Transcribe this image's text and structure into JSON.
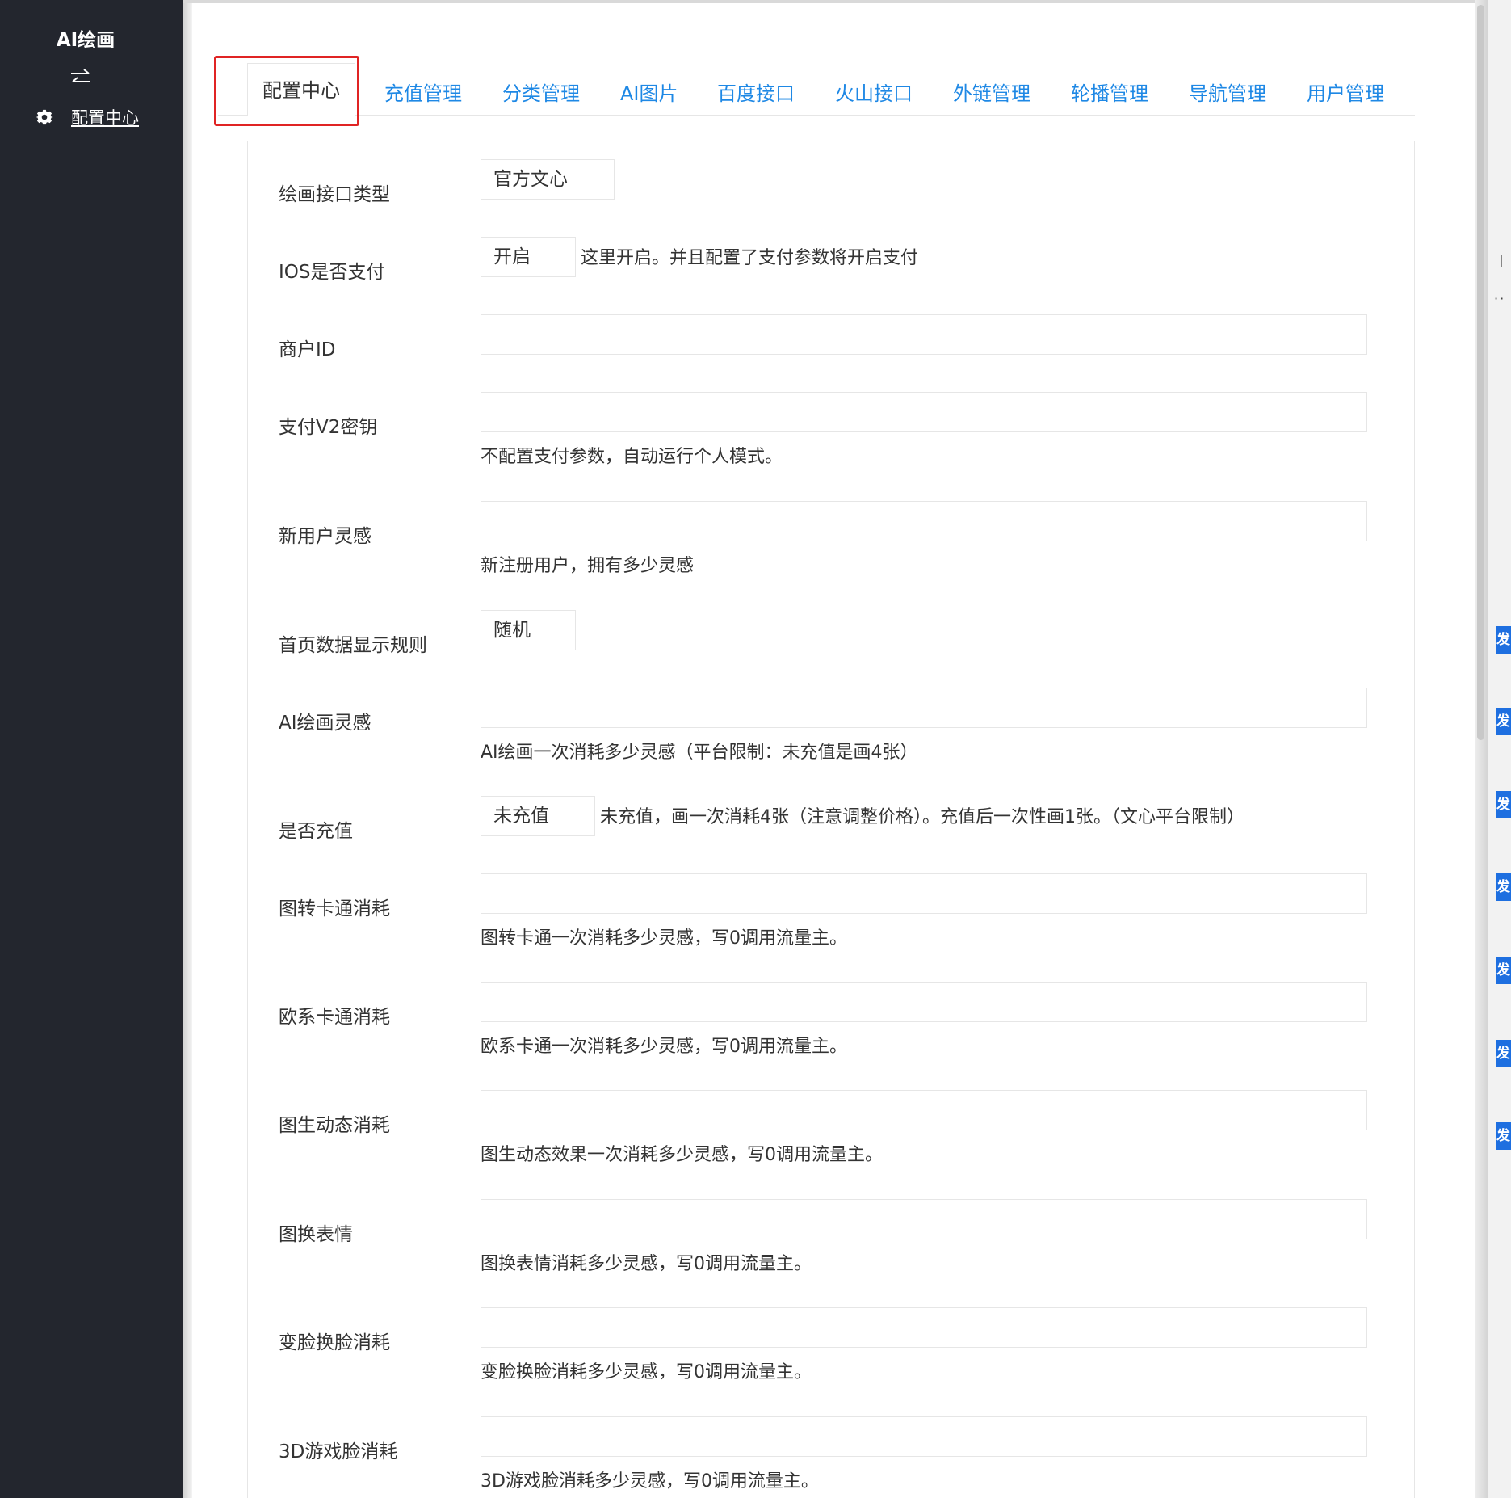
{
  "sidebar": {
    "brand": "AI绘画",
    "toggle_icon": "swap-arrows-icon",
    "nav": [
      {
        "icon": "gear-icon",
        "label": "配置中心"
      }
    ]
  },
  "tabs": [
    {
      "label": "配置中心",
      "active": true
    },
    {
      "label": "充值管理"
    },
    {
      "label": "分类管理"
    },
    {
      "label": "AI图片"
    },
    {
      "label": "百度接口"
    },
    {
      "label": "火山接口"
    },
    {
      "label": "外链管理"
    },
    {
      "label": "轮播管理"
    },
    {
      "label": "导航管理"
    },
    {
      "label": "用户管理"
    }
  ],
  "form": {
    "draw_api_type": {
      "label": "绘画接口类型",
      "value": "官方文心"
    },
    "ios_pay": {
      "label": "IOS是否支付",
      "value": "开启",
      "hint": "这里开启。并且配置了支付参数将开启支付"
    },
    "merchant_id": {
      "label": "商户ID",
      "value": ""
    },
    "pay_v2_key": {
      "label": "支付V2密钥",
      "value": "",
      "hint": "不配置支付参数，自动运行个人模式。"
    },
    "new_user_inspiration": {
      "label": "新用户灵感",
      "value": "",
      "hint": "新注册用户，拥有多少灵感"
    },
    "home_display_rule": {
      "label": "首页数据显示规则",
      "value": "随机"
    },
    "ai_draw_inspiration": {
      "label": "AI绘画灵感",
      "value": "",
      "hint": "AI绘画一次消耗多少灵感（平台限制：未充值是画4张）"
    },
    "recharged": {
      "label": "是否充值",
      "value": "未充值",
      "hint": "未充值，画一次消耗4张（注意调整价格）。充值后一次性画1张。（文心平台限制）"
    },
    "img_to_cartoon": {
      "label": "图转卡通消耗",
      "value": "",
      "hint": "图转卡通一次消耗多少灵感，写0调用流量主。"
    },
    "euro_cartoon": {
      "label": "欧系卡通消耗",
      "value": "",
      "hint": "欧系卡通一次消耗多少灵感，写0调用流量主。"
    },
    "img_to_motion": {
      "label": "图生动态消耗",
      "value": "",
      "hint": "图生动态效果一次消耗多少灵感，写0调用流量主。"
    },
    "img_to_emoji": {
      "label": "图换表情",
      "value": "",
      "hint": "图换表情消耗多少灵感，写0调用流量主。"
    },
    "face_swap": {
      "label": "变脸换脸消耗",
      "value": "",
      "hint": "变脸换脸消耗多少灵感，写0调用流量主。"
    },
    "game_face_3d": {
      "label": "3D游戏脸消耗",
      "value": "",
      "hint": "3D游戏脸消耗多少灵感，写0调用流量主。"
    }
  },
  "right_strip": {
    "button_label": "发"
  },
  "colors": {
    "sidebar_bg": "#23262e",
    "tab_link": "#1e88e5",
    "highlight": "#e02424",
    "side_button": "#1e6fe0"
  }
}
